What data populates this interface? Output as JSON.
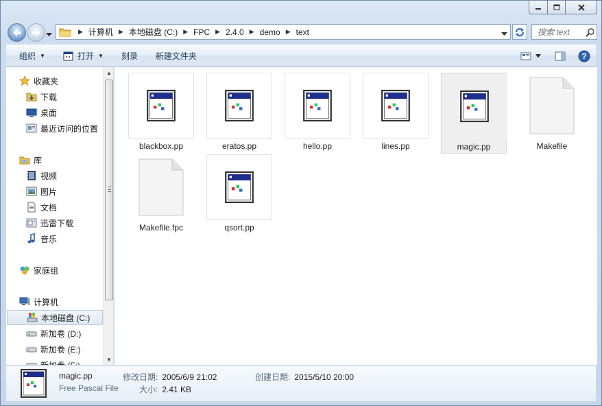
{
  "window": {
    "controls": [
      "minimize-icon",
      "maximize-icon",
      "close-icon"
    ]
  },
  "address_bar": {
    "crumbs": [
      "计算机",
      "本地磁盘 (C:)",
      "FPC",
      "2.4.0",
      "demo",
      "text"
    ]
  },
  "search": {
    "placeholder": "搜索 text"
  },
  "commands": {
    "organize": "组织",
    "open": "打开",
    "burn": "刻录",
    "new_folder": "新建文件夹"
  },
  "nav": {
    "favorites": "收藏夹",
    "downloads": "下载",
    "desktop": "桌面",
    "recent": "最近访问的位置",
    "libraries": "库",
    "videos": "视频",
    "pictures": "图片",
    "documents": "文档",
    "xunlei": "迅雷下载",
    "music": "音乐",
    "homegroup": "家庭组",
    "computer": "计算机",
    "drive_c": "本地磁盘 (C:)",
    "drive_d": "新加卷 (D:)",
    "drive_e": "新加卷 (E:)",
    "drive_f": "新加卷 (F:)"
  },
  "files": [
    {
      "name": "blackbox.pp",
      "kind": "pascal",
      "selected": false
    },
    {
      "name": "eratos.pp",
      "kind": "pascal",
      "selected": false
    },
    {
      "name": "hello.pp",
      "kind": "pascal",
      "selected": false
    },
    {
      "name": "lines.pp",
      "kind": "pascal",
      "selected": false
    },
    {
      "name": "magic.pp",
      "kind": "pascal",
      "selected": true
    },
    {
      "name": "Makefile",
      "kind": "blank",
      "selected": false
    },
    {
      "name": "Makefile.fpc",
      "kind": "blank",
      "selected": false
    },
    {
      "name": "qsort.pp",
      "kind": "pascal",
      "selected": false
    }
  ],
  "details": {
    "name": "magic.pp",
    "type": "Free Pascal File",
    "modified_label": "修改日期:",
    "modified_value": "2005/6/9 21:02",
    "created_label": "创建日期:",
    "created_value": "2015/5/10 20:00",
    "size_label": "大小:",
    "size_value": "2.41 KB"
  },
  "colors": {
    "accent": "#3d6aa3",
    "selection": "#efefef",
    "link_text": "#1e3b5c"
  }
}
